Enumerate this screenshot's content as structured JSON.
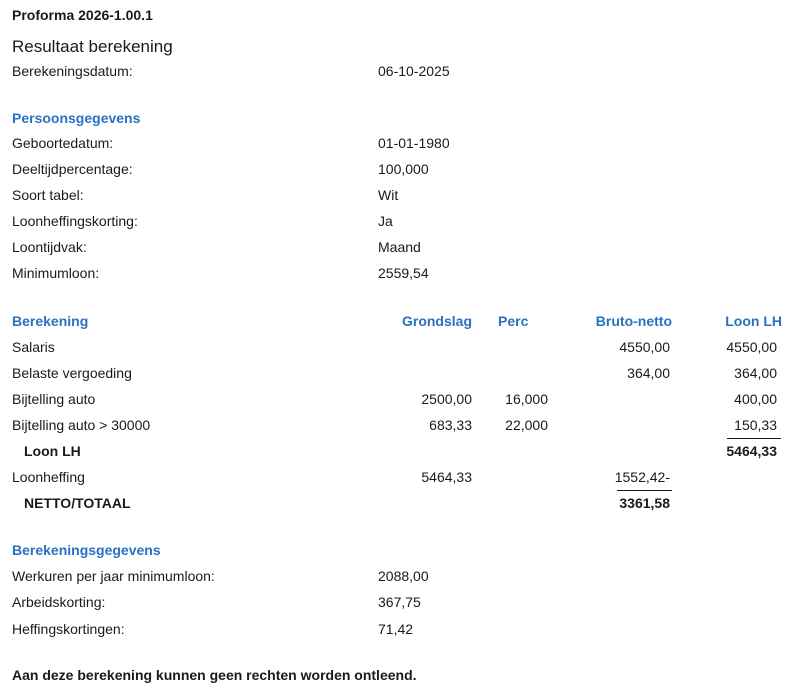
{
  "app_title": "Proforma 2026-1.00.1",
  "page_title": "Resultaat berekening",
  "calc_date": {
    "label": "Berekeningsdatum:",
    "value": "06-10-2025"
  },
  "personal": {
    "heading": "Persoonsgegevens",
    "rows": [
      {
        "label": "Geboortedatum:",
        "value": "01-01-1980"
      },
      {
        "label": "Deeltijdpercentage:",
        "value": "100,000"
      },
      {
        "label": "Soort tabel:",
        "value": "Wit"
      },
      {
        "label": "Loonheffingskorting:",
        "value": "Ja"
      },
      {
        "label": "Loontijdvak:",
        "value": "Maand"
      },
      {
        "label": "Minimumloon:",
        "value": "2559,54"
      }
    ]
  },
  "calculation": {
    "headers": {
      "title": "Berekening",
      "grondslag": "Grondslag",
      "perc": "Perc",
      "bruto_netto": "Bruto-netto",
      "loon_lh": "Loon LH"
    },
    "rows": [
      {
        "label": "Salaris",
        "grondslag": "",
        "perc": "",
        "bruto_netto": "4550,00",
        "loon_lh": "4550,00"
      },
      {
        "label": "Belaste vergoeding",
        "grondslag": "",
        "perc": "",
        "bruto_netto": "364,00",
        "loon_lh": "364,00"
      },
      {
        "label": "Bijtelling auto",
        "grondslag": "2500,00",
        "perc": "16,000",
        "bruto_netto": "",
        "loon_lh": "400,00"
      },
      {
        "label": "Bijtelling auto > 30000",
        "grondslag": "683,33",
        "perc": "22,000",
        "bruto_netto": "",
        "loon_lh": "150,33"
      }
    ],
    "loon_lh_total": {
      "label": "Loon LH",
      "value": "5464,33"
    },
    "loonheffing": {
      "label": "Loonheffing",
      "grondslag": "5464,33",
      "bruto_netto": "1552,42-"
    },
    "netto_totaal": {
      "label": "NETTO/TOTAAL",
      "value": "3361,58"
    }
  },
  "calc_data": {
    "heading": "Berekeningsgegevens",
    "rows": [
      {
        "label": "Werkuren per jaar minimumloon:",
        "value": "2088,00"
      },
      {
        "label": "Arbeidskorting:",
        "value": "367,75"
      },
      {
        "label": "Heffingskortingen:",
        "value": "71,42"
      }
    ]
  },
  "disclaimer": "Aan deze berekening kunnen geen rechten worden ontleend."
}
